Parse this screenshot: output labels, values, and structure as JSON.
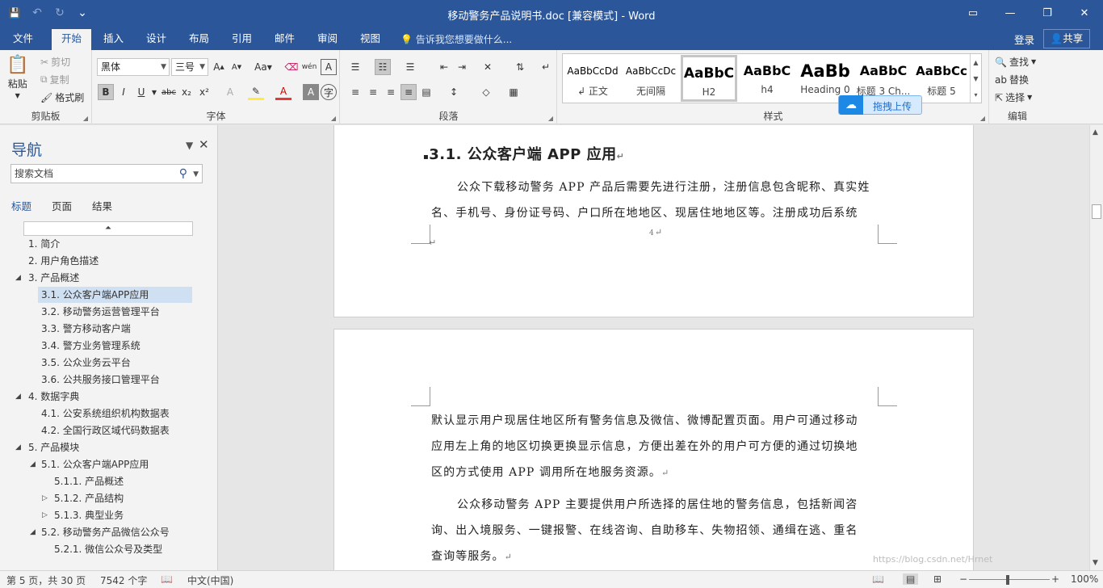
{
  "window": {
    "title": "移动警务产品说明书.doc [兼容模式] - Word"
  },
  "qat": {
    "save": "💾",
    "undo": "↶",
    "redo": "↻",
    "customize": "⌄"
  },
  "winctl": {
    "ribbon_opts": "▭",
    "minimize": "—",
    "restore": "❐",
    "close": "✕"
  },
  "tabs": [
    "文件",
    "开始",
    "插入",
    "设计",
    "布局",
    "引用",
    "邮件",
    "审阅",
    "视图"
  ],
  "tell_me": "告诉我您想要做什么...",
  "account": {
    "login": "登录",
    "share": "共享"
  },
  "ribbon": {
    "clipboard": {
      "paste": "粘贴",
      "cut": "剪切",
      "copy": "复制",
      "painter": "格式刷",
      "label": "剪贴板"
    },
    "font": {
      "family": "黑体",
      "size": "三号",
      "label": "字体",
      "case_btn": "Aa",
      "phonetic": "wén",
      "bold": "B",
      "italic": "I",
      "underline": "U",
      "strike": "abc",
      "sub": "x₂",
      "sup": "x²"
    },
    "paragraph": {
      "label": "段落"
    },
    "styles": {
      "label": "样式",
      "items": [
        {
          "sample": "AaBbCcDd",
          "name": "↲ 正文"
        },
        {
          "sample": "AaBbCcDc",
          "name": "无间隔"
        },
        {
          "sample": "AaBbC",
          "name": "H2"
        },
        {
          "sample": "AaBbC",
          "name": "h4"
        },
        {
          "sample": "AaBb",
          "name": "Heading 0"
        },
        {
          "sample": "AaBbC",
          "name": "标题 3 Ch..."
        },
        {
          "sample": "AaBbCc",
          "name": "标题 5"
        }
      ]
    },
    "editing": {
      "find": "查找",
      "replace": "替换",
      "select": "选择",
      "label": "编辑"
    }
  },
  "upload_pill": "拖拽上传",
  "nav": {
    "title": "导航",
    "search_placeholder": "搜索文档",
    "tabs": [
      "标题",
      "页面",
      "结果"
    ],
    "headings": [
      {
        "text": "1. 简介",
        "level": 1,
        "toggle": ""
      },
      {
        "text": "2. 用户角色描述",
        "level": 1,
        "toggle": ""
      },
      {
        "text": "3. 产品概述",
        "level": 1,
        "toggle": "◢"
      },
      {
        "text": "3.1. 公众客户端APP应用",
        "level": 2,
        "toggle": "",
        "selected": true
      },
      {
        "text": "3.2. 移动警务运营管理平台",
        "level": 2,
        "toggle": ""
      },
      {
        "text": "3.3. 警方移动客户端",
        "level": 2,
        "toggle": ""
      },
      {
        "text": "3.4. 警方业务管理系统",
        "level": 2,
        "toggle": ""
      },
      {
        "text": "3.5. 公众业务云平台",
        "level": 2,
        "toggle": ""
      },
      {
        "text": "3.6. 公共服务接口管理平台",
        "level": 2,
        "toggle": ""
      },
      {
        "text": "4. 数据字典",
        "level": 1,
        "toggle": "◢"
      },
      {
        "text": "4.1. 公安系统组织机构数据表",
        "level": 2,
        "toggle": ""
      },
      {
        "text": "4.2. 全国行政区域代码数据表",
        "level": 2,
        "toggle": ""
      },
      {
        "text": "5. 产品模块",
        "level": 1,
        "toggle": "◢"
      },
      {
        "text": "5.1. 公众客户端APP应用",
        "level": 2,
        "toggle": "◢"
      },
      {
        "text": "5.1.1. 产品概述",
        "level": 3,
        "toggle": ""
      },
      {
        "text": "5.1.2. 产品结构",
        "level": 3,
        "toggle": "▷"
      },
      {
        "text": "5.1.3. 典型业务",
        "level": 3,
        "toggle": "▷"
      },
      {
        "text": "5.2. 移动警务产品微信公众号",
        "level": 2,
        "toggle": "◢"
      },
      {
        "text": "5.2.1. 微信公众号及类型",
        "level": 3,
        "toggle": ""
      }
    ]
  },
  "document": {
    "heading": "3.1. 公众客户端 APP 应用",
    "p1_line1": "公众下载移动警务 APP 产品后需要先进行注册，注册信息包含昵称、真实姓",
    "p1_line2": "名、手机号、身份证号码、户口所在地地区、现居住地地区等。注册成功后系统",
    "page_number": "4",
    "p2_line1": "默认显示用户现居住地区所有警务信息及微信、微博配置页面。用户可通过移动",
    "p2_line2": "应用左上角的地区切换更换显示信息，方便出差在外的用户可方便的通过切换地",
    "p2_line3": "区的方式使用 APP 调用所在地服务资源。",
    "p3_line1": "公众移动警务 APP 主要提供用户所选择的居住地的警务信息，包括新闻咨",
    "p3_line2": "询、出入境服务、一键报警、在线咨询、自助移车、失物招领、通缉在逃、重名",
    "p3_line3": "查询等服务。",
    "watermark": "https://blog.csdn.net/Hrnet"
  },
  "status": {
    "page": "第 5 页，共 30 页",
    "words": "7542 个字",
    "language": "中文(中国)",
    "zoom": "100%"
  }
}
